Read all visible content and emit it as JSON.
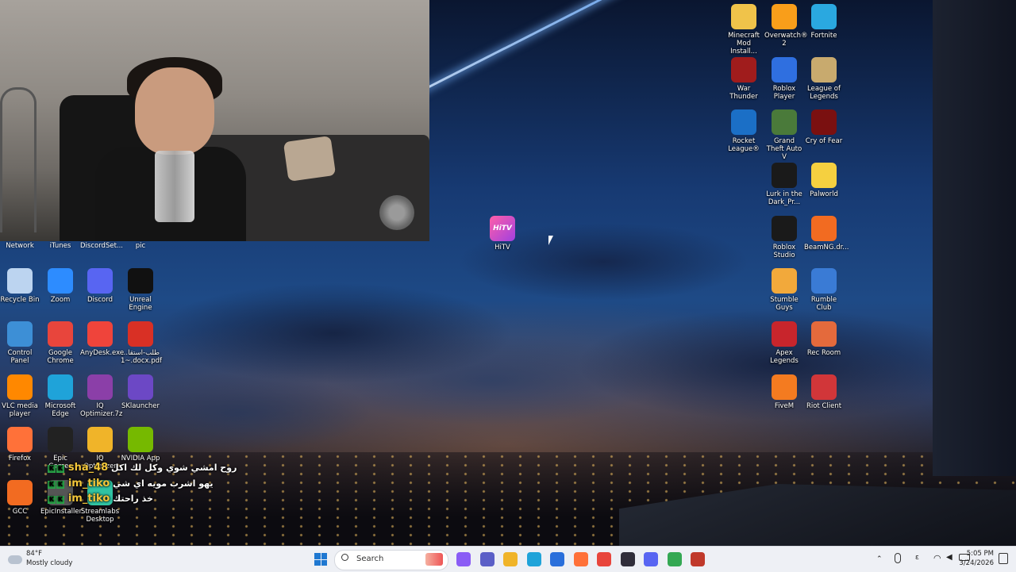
{
  "desktop": {
    "top_row_labels": [
      "Network",
      "iTunes",
      "DiscordSet...",
      "pic"
    ],
    "left_icons": [
      {
        "label": "Recycle Bin",
        "icon": "recycle-bin-icon",
        "color": "#bcd4f0"
      },
      {
        "label": "Zoom",
        "icon": "zoom-icon",
        "color": "#2d8cff"
      },
      {
        "label": "Discord",
        "icon": "discord-icon",
        "color": "#5865f2"
      },
      {
        "label": "Unreal Engine",
        "icon": "unreal-engine-icon",
        "color": "#111111"
      },
      {
        "label": "Control Panel",
        "icon": "control-panel-icon",
        "color": "#3d8fd6"
      },
      {
        "label": "Google Chrome",
        "icon": "chrome-icon",
        "color": "#e8453c"
      },
      {
        "label": "AnyDesk.exe",
        "icon": "anydesk-icon",
        "color": "#ef443b"
      },
      {
        "label": "طلب-استقا... ~1.docx.pdf",
        "icon": "pdf-icon",
        "color": "#d93025"
      },
      {
        "label": "VLC media player",
        "icon": "vlc-icon",
        "color": "#ff8800"
      },
      {
        "label": "Microsoft Edge",
        "icon": "edge-icon",
        "color": "#1fa3d9"
      },
      {
        "label": "IQ Optimizer.7z",
        "icon": "archive-icon",
        "color": "#8b3fa8"
      },
      {
        "label": "SKlauncher",
        "icon": "sklauncher-icon",
        "color": "#6c48c5"
      },
      {
        "label": "Firefox",
        "icon": "firefox-icon",
        "color": "#ff7139"
      },
      {
        "label": "Epic Games",
        "icon": "epic-games-icon",
        "color": "#222222"
      },
      {
        "label": "IQ Optimizer",
        "icon": "folder-icon",
        "color": "#f0b429"
      },
      {
        "label": "NVIDIA App",
        "icon": "nvidia-icon",
        "color": "#76b900"
      },
      {
        "label": "GCC",
        "icon": "gcc-icon",
        "color": "#f26b21"
      },
      {
        "label": "EpicInstaller...",
        "icon": "installer-icon",
        "color": "#555555"
      },
      {
        "label": "Streamlabs Desktop",
        "icon": "streamlabs-icon",
        "color": "#31c3a2"
      }
    ],
    "center_icon": {
      "label": "HiTV",
      "icon": "hitv-icon",
      "color": "#e040a0"
    },
    "right_icons": [
      {
        "label": "Minecraft Mod Install...",
        "icon": "folder-icon",
        "color": "#f0c34a"
      },
      {
        "label": "Overwatch® 2",
        "icon": "overwatch-icon",
        "color": "#f99e1a"
      },
      {
        "label": "Fortnite",
        "icon": "fortnite-icon",
        "color": "#2aa8e0"
      },
      {
        "label": "War Thunder",
        "icon": "war-thunder-icon",
        "color": "#a01c1c"
      },
      {
        "label": "Roblox Player",
        "icon": "roblox-icon",
        "color": "#2f6fe0"
      },
      {
        "label": "League of Legends",
        "icon": "league-icon",
        "color": "#c8aa6e"
      },
      {
        "label": "Rocket League®",
        "icon": "rocket-league-icon",
        "color": "#1b6fc6"
      },
      {
        "label": "Grand Theft Auto V",
        "icon": "gta-icon",
        "color": "#4a7a3a"
      },
      {
        "label": "Cry of Fear",
        "icon": "cry-of-fear-icon",
        "color": "#7a1010"
      },
      {
        "label": "Lurk in the Dark_Pr...",
        "icon": "lurk-icon",
        "color": "#1a1a1a"
      },
      {
        "label": "Palworld",
        "icon": "palworld-icon",
        "color": "#f5d040"
      },
      {
        "label": "Roblox Studio",
        "icon": "roblox-studio-icon",
        "color": "#1a1a1a"
      },
      {
        "label": "BeamNG.dr...",
        "icon": "beamng-icon",
        "color": "#f26b21"
      },
      {
        "label": "Stumble Guys",
        "icon": "stumble-guys-icon",
        "color": "#f2a93b"
      },
      {
        "label": "Rumble Club",
        "icon": "rumble-club-icon",
        "color": "#3a7bd5"
      },
      {
        "label": "Apex Legends",
        "icon": "apex-icon",
        "color": "#c8252c"
      },
      {
        "label": "Rec Room",
        "icon": "rec-room-icon",
        "color": "#e46a3c"
      },
      {
        "label": "FiveM",
        "icon": "fivem-icon",
        "color": "#f47b20"
      },
      {
        "label": "Riot Client",
        "icon": "riot-icon",
        "color": "#d13639"
      }
    ]
  },
  "chat": [
    {
      "user": "sha_48",
      "message": "روح امشي شوي وكل لك اكل"
    },
    {
      "user": "im_tiko",
      "message": "يهو اشرب مويه اي شي"
    },
    {
      "user": "im_tiko",
      "message": "خذ راحتك"
    }
  ],
  "taskbar": {
    "weather": {
      "temp": "84°F",
      "condition": "Mostly cloudy"
    },
    "search_placeholder": "Search",
    "pinned": [
      {
        "name": "copilot-icon",
        "color": "#8a5cf5"
      },
      {
        "name": "teams-icon",
        "color": "#5b5fc7"
      },
      {
        "name": "file-explorer-icon",
        "color": "#f0b429"
      },
      {
        "name": "edge-icon",
        "color": "#1fa3d9"
      },
      {
        "name": "store-icon",
        "color": "#2a6fdb"
      },
      {
        "name": "firefox-icon",
        "color": "#ff7139"
      },
      {
        "name": "chrome-icon",
        "color": "#e8453c"
      },
      {
        "name": "obs-icon",
        "color": "#302e3a"
      },
      {
        "name": "discord-icon",
        "color": "#5865f2"
      },
      {
        "name": "chrome-profile-icon",
        "color": "#34a853"
      },
      {
        "name": "app-icon",
        "color": "#c0392b"
      }
    ],
    "tray": {
      "lang": "ε",
      "time": "5:05 PM",
      "date": "3/24/2026"
    }
  }
}
